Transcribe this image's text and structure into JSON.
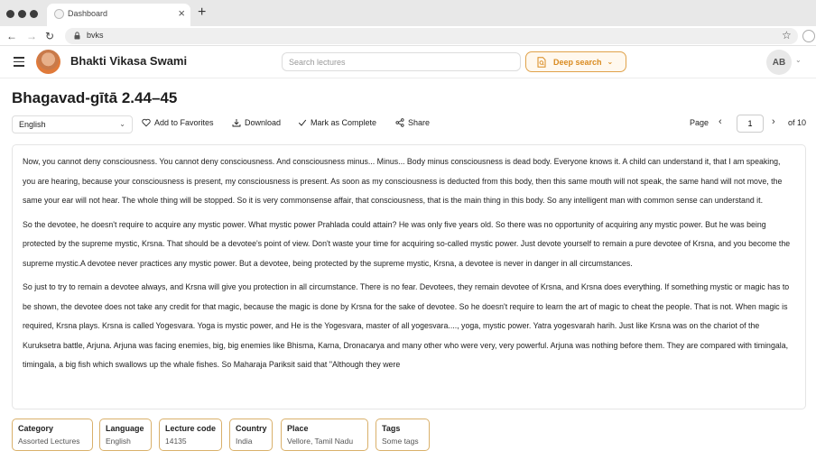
{
  "browser": {
    "tab_title": "Dashboard",
    "tab_close": "×",
    "new_tab": "+",
    "url": "bvks"
  },
  "header": {
    "site_title": "Bhakti Vikasa Swami",
    "search_placeholder": "Search lectures",
    "deep_search_label": "Deep search",
    "user_initials": "AB"
  },
  "lecture": {
    "title": "Bhagavad-gītā 2.44–45"
  },
  "toolbar": {
    "language": "English",
    "add_favorites": "Add to Favorites",
    "download": "Download",
    "mark_complete": "Mark as Complete",
    "share": "Share",
    "page_label": "Page",
    "current_page": "1",
    "total_pages": "of 10"
  },
  "transcript": {
    "paragraphs": [
      "Now, you cannot deny consciousness. You cannot deny consciousness. And consciousness minus... Minus... Body minus consciousness is dead body. Everyone knows it. A child can understand it, that I am speaking, you are hearing, because your consciousness is present, my consciousness is present. As soon as my consciousness is deducted from this body, then this same mouth will not speak, the same hand will not move, the same your ear will not hear. The whole thing will be stopped. So it is very commonsense affair, that consciousness, that is the main thing in this body. So any intelligent man with common sense can understand it.",
      "So the devotee, he doesn't require to acquire any mystic power. What mystic power Prahlada could attain? He was only five years old. So there was no opportunity of acquiring any mystic power. But he was being protected by the supreme mystic, Krsna. That should be a devotee's point of view. Don't waste your time for acquiring so-called mystic power. Just devote yourself to remain a pure devotee of Krsna, and you become the supreme mystic.A devotee never practices any mystic power. But a devotee, being protected by the supreme mystic, Krsna, a devotee is never in danger in all circumstances.",
      "So just to try to remain a devotee always, and Krsna will give you protection in all circumstance. There is no fear. Devotees, they remain devotee of Krsna, and Krsna does everything. If something mystic or magic has to be shown, the devotee does not take any credit for that magic, because the magic is done by Krsna for the sake of devotee. So he doesn't require to learn the art of magic to cheat the people. That is not. When magic is required, Krsna plays. Krsna is called Yogesvara. Yoga is mystic power, and He is the Yogesvara, master of all yogesvara...., yoga, mystic power. Yatra yogesvarah harih. Just like Krsna was on the chariot of the Kuruksetra battle, Arjuna. Arjuna was facing enemies, big, big enemies like Bhisma, Karna, Dronacarya and many other who were very, very powerful. Arjuna was nothing before them. They are compared with timingala, timingala, a big fish which swallows up the whale fishes. So Maharaja Pariksit said that \"Although they were"
    ]
  },
  "meta": [
    {
      "label": "Category",
      "value": "Assorted Lectures"
    },
    {
      "label": "Language",
      "value": "English"
    },
    {
      "label": "Lecture code",
      "value": "14135"
    },
    {
      "label": "Country",
      "value": "India"
    },
    {
      "label": "Place",
      "value": "Vellore, Tamil Nadu"
    },
    {
      "label": "Tags",
      "value": "Some tags"
    }
  ],
  "colors": {
    "accent": "#d98a1f",
    "card_border": "#d9b06a"
  }
}
